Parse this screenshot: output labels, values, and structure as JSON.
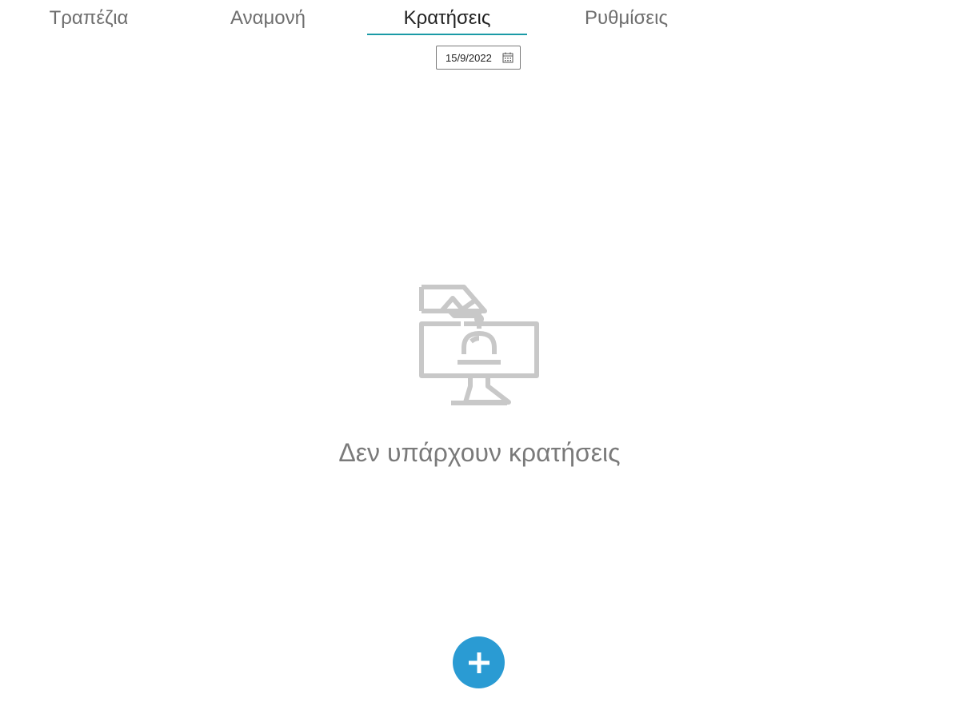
{
  "tabs": [
    {
      "label": "Τραπέζια",
      "selected": false
    },
    {
      "label": "Αναμονή",
      "selected": false
    },
    {
      "label": "Κρατήσεις",
      "selected": true
    },
    {
      "label": "Ρυθμίσεις",
      "selected": false
    }
  ],
  "date_picker": {
    "value": "15/9/2022",
    "icon": "calendar-icon"
  },
  "empty_state": {
    "icon": "reception-bell-icon",
    "message": "Δεν υπάρχουν κρατήσεις"
  },
  "fab": {
    "icon": "plus-icon"
  },
  "colors": {
    "accent_underline": "#1a9aa6",
    "fab_background": "#2a9bd3",
    "illustration": "#c8c8c8",
    "tab_text": "#6e6e6e",
    "tab_text_selected": "#222222",
    "empty_text": "#7a7a7a"
  }
}
